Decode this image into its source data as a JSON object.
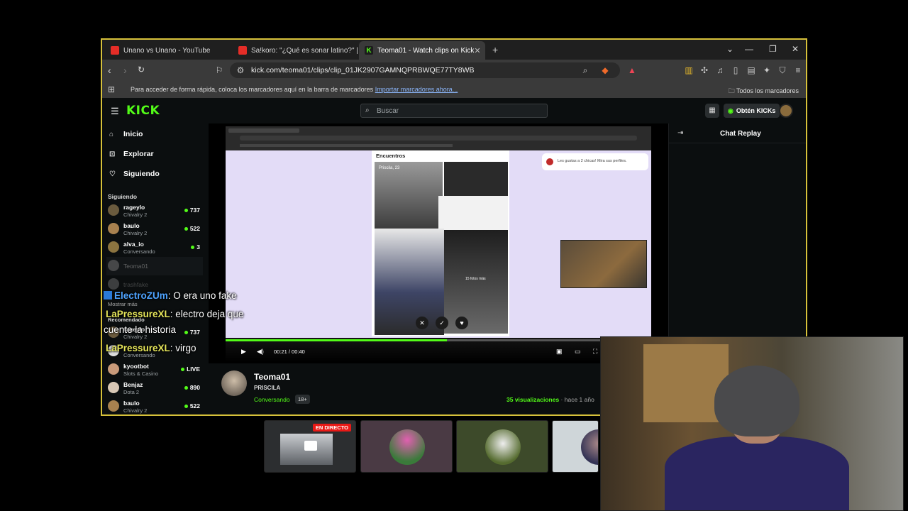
{
  "browser": {
    "tabs": [
      {
        "title": "Unano vs Unano - YouTube",
        "icon": "youtube-icon",
        "active": false
      },
      {
        "title": "Sa!koro: \"¿Qué es sonar latino?\" | Em",
        "icon": "youtube-icon",
        "active": false
      },
      {
        "title": "Teoma01 - Watch clips on Kick",
        "icon": "kick-icon",
        "active": true
      }
    ],
    "url": "kick.com/teoma01/clips/clip_01JK2907GAMNQPRBWQE77TY8WB",
    "bookmarks_message": "Para acceder de forma rápida, coloca los marcadores aquí en la barra de marcadores",
    "bookmarks_link": "Importar marcadores ahora...",
    "all_bookmarks": "Todos los marcadores"
  },
  "kick": {
    "logo": "KICK",
    "search_placeholder": "Buscar",
    "kicks_button": "Obtén KICKs",
    "nav": [
      {
        "label": "Inicio",
        "icon": "home-icon"
      },
      {
        "label": "Explorar",
        "icon": "compass-icon"
      },
      {
        "label": "Siguiendo",
        "icon": "heart-icon"
      }
    ],
    "following_title": "Siguiendo",
    "following": [
      {
        "name": "rageylo",
        "category": "Chivalry 2",
        "viewers": "737"
      },
      {
        "name": "baulo",
        "category": "Chivalry 2",
        "viewers": "522"
      },
      {
        "name": "alva_io",
        "category": "Conversando",
        "viewers": "3"
      },
      {
        "name": "Teoma01",
        "category": "",
        "viewers": ""
      },
      {
        "name": "trashfake",
        "category": "",
        "viewers": ""
      }
    ],
    "show_more": "Mostrar más",
    "recommended_title": "Recomendado",
    "recommended": [
      {
        "name": "rageylo",
        "category": "Chivalry 2",
        "viewers": "737"
      },
      {
        "name": "",
        "category": "Conversando",
        "viewers": ""
      },
      {
        "name": "kyootbot",
        "category": "Slots & Casino",
        "viewers": "LIVE"
      },
      {
        "name": "Benjaz",
        "category": "Dota 2",
        "viewers": "890"
      },
      {
        "name": "baulo",
        "category": "Chivalry 2",
        "viewers": "522"
      }
    ],
    "chat_replay": "Chat Replay",
    "player": {
      "time": "00:21 / 00:40",
      "progress": 0.52
    },
    "inner": {
      "section_title": "Encuentros",
      "profile_label": "Priscila, 23",
      "more_photos": "15 fotos más",
      "notification": "Les gustas a 2 chicas! Mira sus perfiles."
    },
    "streamer": {
      "name": "Teoma01",
      "clip_title": "PRISCILA",
      "category": "Conversando",
      "age_badge": "18+",
      "views_count": "35 visualizaciones",
      "time_ago": "hace 1 año"
    }
  },
  "overlay_chat": [
    {
      "user": "ElectroZUm",
      "text": ": O era uno fake",
      "color": "#4ea3ff"
    },
    {
      "user": "LaPressureXL",
      "text": ": electro deja que",
      "color": "#e6e65a"
    },
    {
      "user": "",
      "text": "cuente la historia",
      "color": "#ffffff"
    },
    {
      "user": "LaPressureXL",
      "text": ": virgo",
      "color": "#e6e65a"
    }
  ],
  "thumbnails": [
    {
      "badge": "EN DIRECTO"
    }
  ],
  "colors": {
    "kick_green": "#53fc18",
    "window_border": "#d7c13a",
    "live_red": "#e91916"
  }
}
